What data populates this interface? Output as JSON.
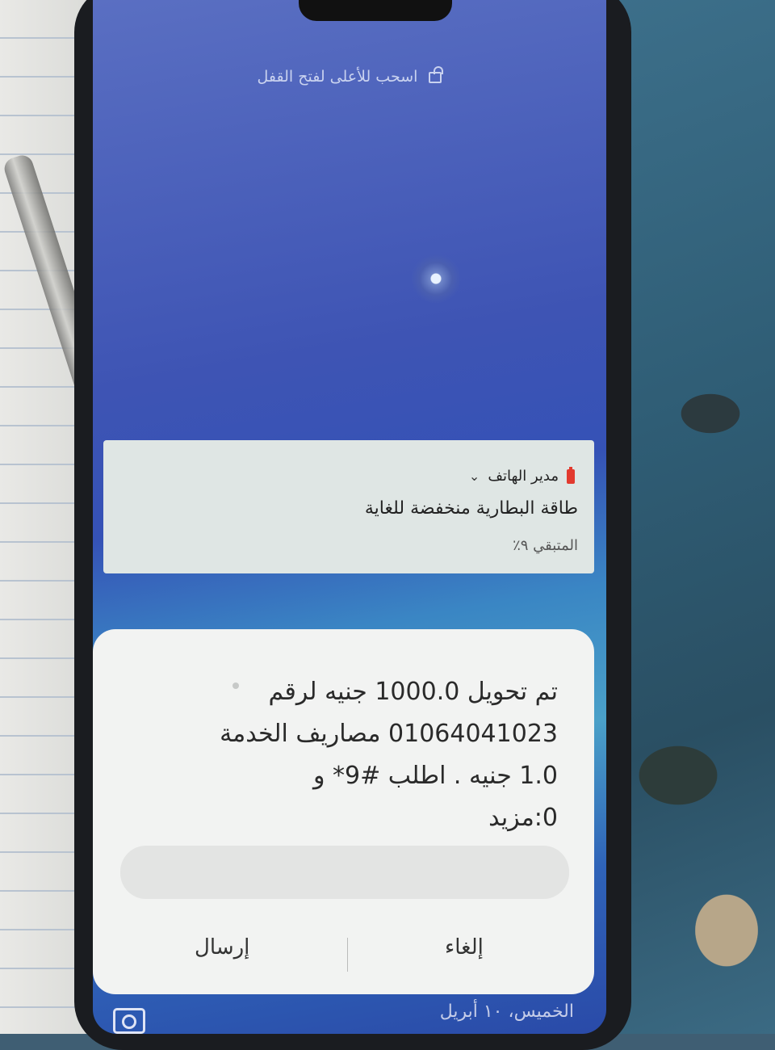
{
  "lockscreen": {
    "unlock_hint": "اسحب للأعلى لفتح القفل",
    "date": "الخميس، ١٠ أبريل"
  },
  "notification": {
    "app_name": "مدير الهاتف",
    "title": "طاقة البطارية منخفضة للغاية",
    "subtitle": "المتبقي ٩٪"
  },
  "ussd_dialog": {
    "message_line1": "تم تحويل 1000.0 جنيه لرقم",
    "message_line2": "01064041023 مصاريف الخدمة",
    "message_line3": "1.0 جنيه . اطلب #9* و",
    "message_line4": "0:مزيد",
    "input_value": "",
    "cancel_label": "إلغاء",
    "send_label": "إرسال"
  },
  "colors": {
    "battery_icon": "#e23a2e",
    "dialog_bg": "#f2f3f2",
    "notification_bg": "#dfe6e4"
  }
}
